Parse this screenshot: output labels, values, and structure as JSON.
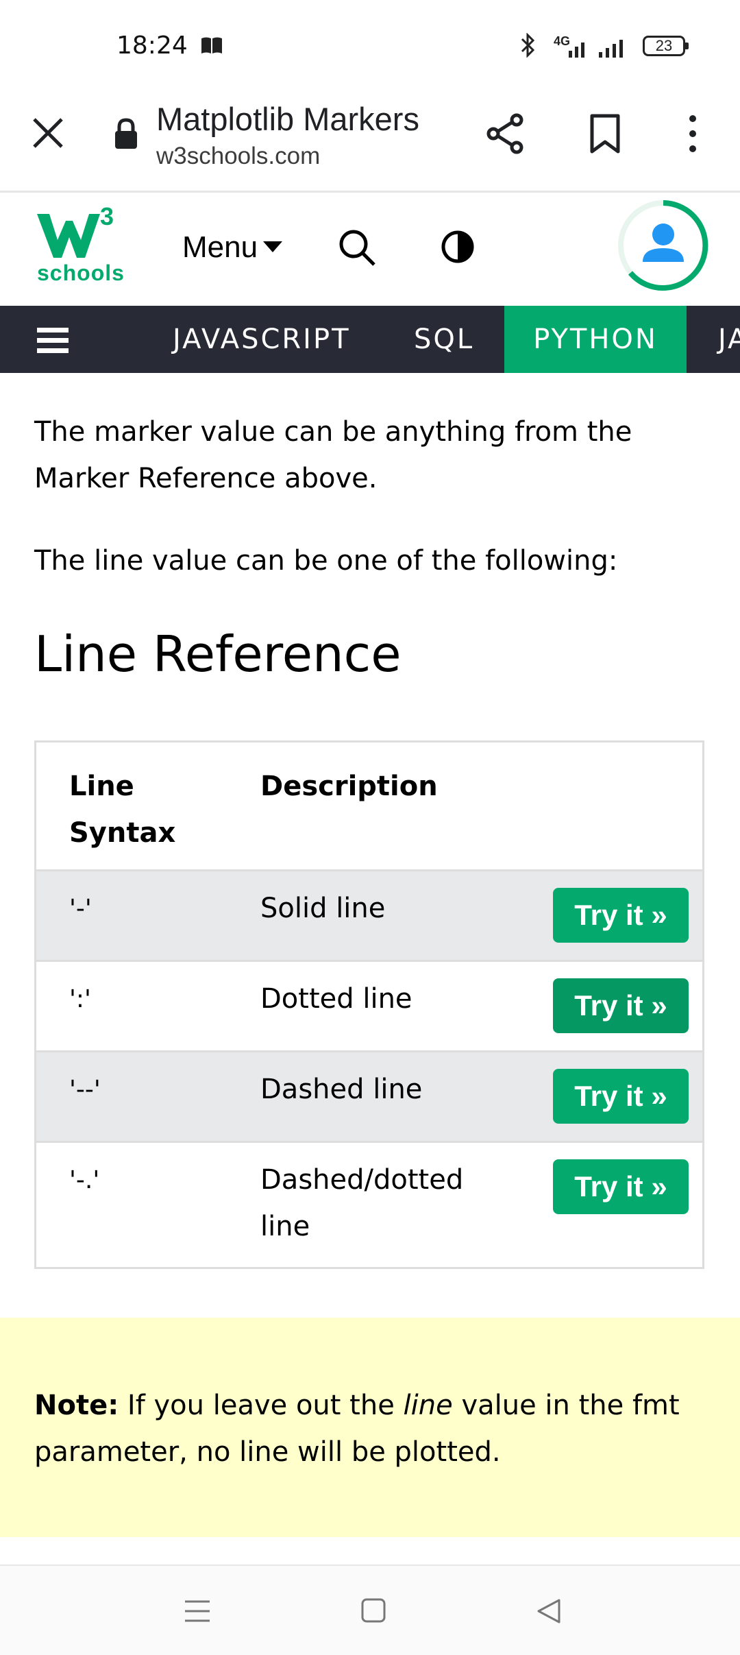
{
  "status": {
    "time": "18:24",
    "network": "4G",
    "battery": "23"
  },
  "toolbar": {
    "title": "Matplotlib Markers",
    "domain": "w3schools.com"
  },
  "header": {
    "logo_text": "schools",
    "menu_label": "Menu"
  },
  "nav": {
    "items": [
      "JAVASCRIPT",
      "SQL",
      "PYTHON",
      "JA"
    ]
  },
  "content": {
    "para1_line1": "The marker value can be anything from the",
    "para1_line2": "Marker Reference above.",
    "para2": "The line value can be one of the following:",
    "heading": "Line Reference",
    "table": {
      "header_syntax_1": "Line",
      "header_syntax_2": "Syntax",
      "header_desc": "Description",
      "rows": [
        {
          "syntax": "'-'",
          "desc_1": "Solid line",
          "desc_2": "",
          "button": "Try it »"
        },
        {
          "syntax": "':'",
          "desc_1": "Dotted line",
          "desc_2": "",
          "button": "Try it »"
        },
        {
          "syntax": "'--'",
          "desc_1": "Dashed line",
          "desc_2": "",
          "button": "Try it »"
        },
        {
          "syntax": "'-.'",
          "desc_1": "Dashed/dotted",
          "desc_2": "line",
          "button": "Try it »"
        }
      ]
    },
    "note": {
      "label": "Note:",
      "text_before": " If you leave out the ",
      "text_italic": "line",
      "text_after": " value in the fmt",
      "line2": "parameter, no line will be plotted."
    }
  },
  "colors": {
    "brand": "#04aa6d",
    "nav_bg": "#282a35",
    "note_bg": "#ffffcc",
    "row_alt": "#e7e9eb"
  }
}
